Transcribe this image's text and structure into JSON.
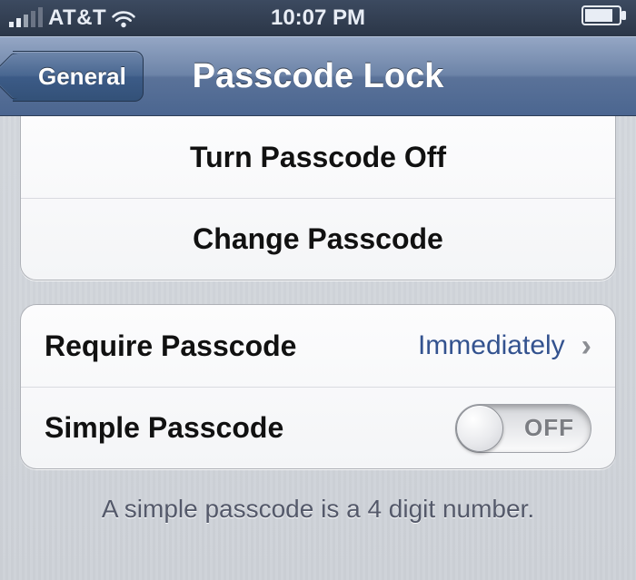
{
  "status_bar": {
    "carrier": "AT&T",
    "time": "10:07 PM"
  },
  "nav": {
    "back_label": "General",
    "title": "Passcode Lock"
  },
  "group1": {
    "turn_off": "Turn Passcode Off",
    "change": "Change Passcode"
  },
  "group2": {
    "require_label": "Require Passcode",
    "require_value": "Immediately",
    "simple_label": "Simple Passcode",
    "simple_toggle_state": "OFF"
  },
  "footer": {
    "hint": "A simple passcode is a 4 digit number."
  }
}
